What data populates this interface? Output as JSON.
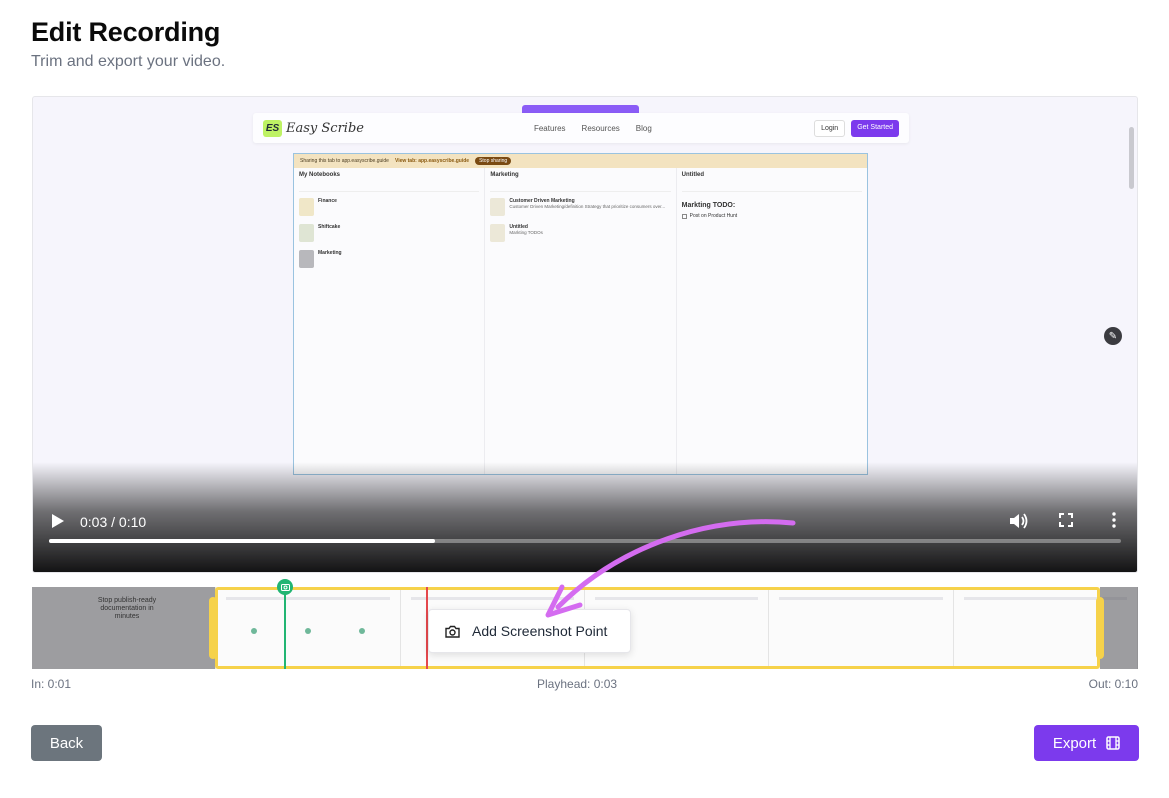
{
  "page": {
    "title": "Edit Recording",
    "subtitle": "Trim and export your video."
  },
  "video": {
    "current_time": "0:03",
    "duration": "0:10",
    "time_display": "0:03 / 0:10",
    "progress_fraction": 0.36,
    "content": {
      "logo_mark": "ES",
      "logo_name": "Easy Scribe",
      "nav_links": [
        "Features",
        "Resources",
        "Blog"
      ],
      "login_label": "Login",
      "get_started_label": "Get Started",
      "banner_text": "Sharing this tab to app.easyscribe.guide",
      "banner_link": "View tab: app.easyscribe.guide",
      "banner_button": "Stop sharing",
      "notebooks_header": "My Notebooks",
      "notebooks": [
        {
          "title": "Finance"
        },
        {
          "title": "Shiftcake"
        },
        {
          "title": "Marketing"
        }
      ],
      "marketing_header": "Marketing",
      "marketing_notes": [
        {
          "title": "Customer Driven Marketing",
          "snippet": "Customer Driven Marketing/definition Strategy that prioritize consumers over..."
        },
        {
          "title": "Untitled",
          "snippet": "Markting TODOs"
        }
      ],
      "untitled_header": "Untitled",
      "doc_title": "Markting TODO:",
      "doc_item": "Post on Product Hunt"
    }
  },
  "timeline": {
    "in_label": "In: 0:01",
    "playhead_label": "Playhead: 0:03",
    "out_label": "Out: 0:10",
    "preview_text": "Stop publish-ready documentation in minutes",
    "context_menu_item": "Add Screenshot Point"
  },
  "actions": {
    "back_label": "Back",
    "export_label": "Export"
  },
  "colors": {
    "accent": "#7c3aed",
    "trim": "#f6d24a",
    "screenshot_marker": "#22b573",
    "playhead": "#e5484d",
    "back_button": "#6c757d",
    "annotation_arrow": "#d46cf0"
  }
}
